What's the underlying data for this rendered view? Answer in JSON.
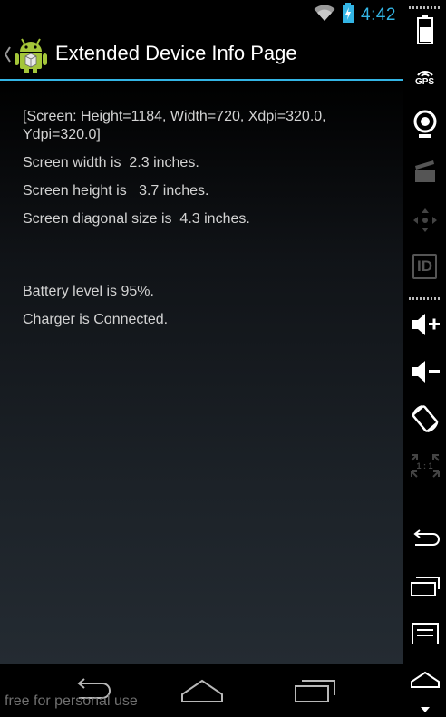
{
  "status_bar": {
    "time": "4:42",
    "icons": [
      "wifi-icon",
      "battery-charging-icon"
    ]
  },
  "action_bar": {
    "title": "Extended Device Info Page",
    "app_icon": "android-robot-icon",
    "up_icon": "up-caret-icon"
  },
  "content": {
    "screen_info": "[Screen: Height=1184, Width=720, Xdpi=320.0, Ydpi=320.0]",
    "screen_width": "Screen width is  2.3 inches.",
    "screen_height": "Screen height is   3.7 inches.",
    "screen_diagonal": "Screen diagonal size is  4.3 inches.",
    "battery_level": "Battery level is 95%.",
    "charger_status": "Charger is Connected."
  },
  "nav_bar": {
    "buttons": [
      "back-icon",
      "home-icon",
      "recents-icon"
    ]
  },
  "watermark": "free for personal use",
  "emulator_controls": {
    "gps_label": "GPS",
    "id_label": "ID",
    "scale_label": "1 : 1",
    "buttons": [
      "battery-icon",
      "gps-icon",
      "camera-icon",
      "video-icon",
      "dpad-icon",
      "id-icon",
      "volume-up-icon",
      "volume-down-icon",
      "rotate-icon",
      "scale-icon",
      "back-icon",
      "recents-icon",
      "menu-icon",
      "home-icon"
    ]
  },
  "colors": {
    "accent": "#33b5e5",
    "text": "#d3d3d3"
  }
}
